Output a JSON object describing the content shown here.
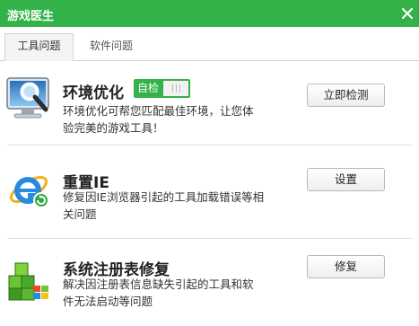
{
  "window": {
    "title": "游戏医生"
  },
  "tabs": [
    {
      "label": "工具问题",
      "active": true
    },
    {
      "label": "软件问题",
      "active": false
    }
  ],
  "items": [
    {
      "title": "环境优化",
      "toggle_label": "自检",
      "desc_line1": "环境优化可帮您匹配最佳环境，让您体",
      "desc_line2": "验完美的游戏工具！",
      "button": "立即检测",
      "icon": "monitor-search-icon"
    },
    {
      "title": "重置IE",
      "desc_line1": "修复因IE浏览器引起的工具加载错误等相",
      "desc_line2": "关问题",
      "button": "设置",
      "icon": "ie-reset-icon"
    },
    {
      "title": "系统注册表修复",
      "desc_line1": "解决因注册表信息缺失引起的工具和软",
      "desc_line2": "件无法启动等问题",
      "button": "修复",
      "icon": "registry-cubes-icon"
    }
  ],
  "colors": {
    "accent": "#33b24a",
    "title_text": "#ffffff"
  }
}
